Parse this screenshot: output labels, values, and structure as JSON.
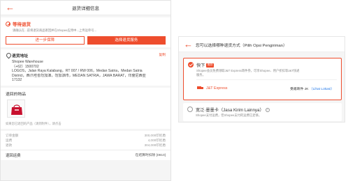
{
  "left": {
    "header": {
      "title": "退货详细信息"
    },
    "status": {
      "title": "等待退货",
      "description": "请确认在...前将退货商品寄回并在Shopee应用中...上传运单号..."
    },
    "buttons": {
      "secondary": "进一步保障",
      "primary": "选择退货服务"
    },
    "address": {
      "title": "退货地址",
      "copy_label": "复制",
      "lines": [
        "Shopee Warehouse",
        "（+62）1500702",
        "LOGOS，Jalan Raya Kalabang，RT 007 / RW 006，Medan Satria，Medan Satria",
        "District，西爪哇省勿加泗，勿加泗市，MEDAN SATRIA，JAWA BARAT，印度尼西亚",
        "17132"
      ]
    },
    "items": {
      "title": "退回的物品",
      "note": "如果您已退回的产品（请到附件），请点击"
    },
    "summary": [
      {
        "label": "订单金额",
        "value": "300,000印尼盾"
      },
      {
        "label": "运费",
        "value": "4,000印尼盾"
      },
      {
        "label": "退款",
        "value": "304,000印尼盾"
      }
    ],
    "fee": {
      "label": "退回运费",
      "value": "在结算时扣除 [0810]"
    }
  },
  "right": {
    "header": {
      "title": "您可以选择哪种退货方式（Pilih Opsi Pengiriman）"
    },
    "option1": {
      "title": "快下",
      "badge": "推荐",
      "description": "Shopee会员免费领取J&T Express寄件券，可享Shopee、用户折扣等J&T快递服务。",
      "carrier": "J&T Express",
      "location_label": "受邀寄件·JK",
      "location_link": "（Lihat Lokasi）"
    },
    "option2": {
      "title": "宽泛·墨墨卡（Jasa Kirim Lainnya）",
      "description": "Shopee支付运费，但Shopee支付的运费已足够。"
    }
  },
  "colors": {
    "accent": "#ee4d2d",
    "link": "#1a73e8"
  }
}
